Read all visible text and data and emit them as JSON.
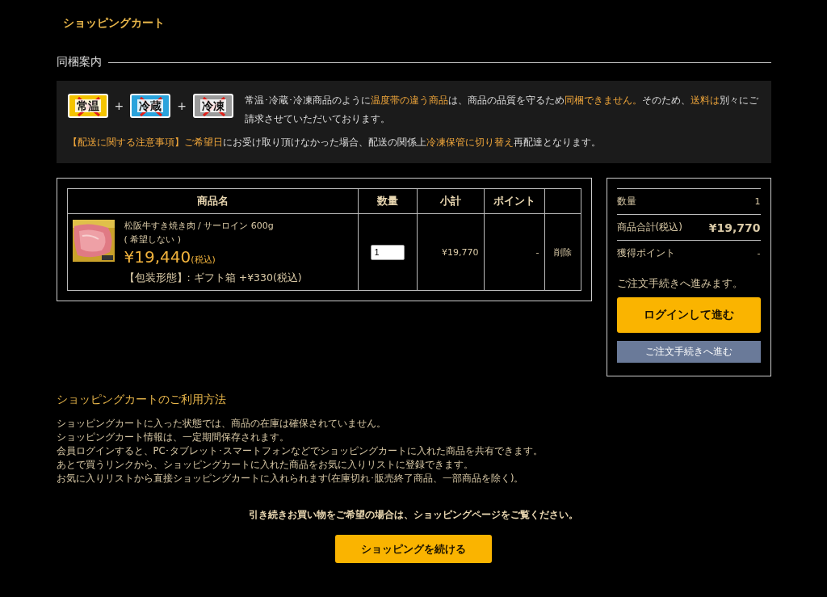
{
  "title": "ショッピングカート",
  "bundle_notice": {
    "heading": "同梱案内",
    "badges": [
      {
        "label": "常温",
        "color": "#f5c400"
      },
      {
        "label": "冷蔵",
        "color": "#2aa3dc"
      },
      {
        "label": "冷凍",
        "color": "#9a9a9a"
      }
    ],
    "separators": [
      "+",
      "+"
    ],
    "message": "常温･冷蔵･冷凍商品のように**温度帯の違う商品**は、商品の品質を守るため**同梱できません。**そのため、**送料は**別々にご請求させていただいております。",
    "caution": "**【配送に関する注意事項】ご希望日**にお受け取り頂けなかった場合、配送の関係上**冷凍保管に切り替え**再配達となります。"
  },
  "cart": {
    "columns": [
      "商品名",
      "数量",
      "小計",
      "ポイント"
    ],
    "item": {
      "name": "松阪牛すき焼き肉 / サーロイン 600g",
      "option": "( 希望しない )",
      "price": "¥19,440",
      "tax_note": "(税込)",
      "wrapping": "【包装形態】: ギフト箱 +¥330(税込)",
      "quantity": "1",
      "subtotal": "¥19,770",
      "points": "-",
      "delete": "削除"
    }
  },
  "summary": {
    "rows": [
      {
        "label": "数量",
        "value": "1",
        "kind": "plain"
      },
      {
        "label": "商品合計(税込)",
        "value": "¥19,770",
        "kind": "total"
      },
      {
        "label": "獲得ポイント",
        "value": "-",
        "kind": "plain"
      }
    ],
    "note": "ご注文手続きへ進みます。",
    "login_button": "ログインして進む",
    "proceed_button": "ご注文手続きへ進む"
  },
  "usage": {
    "heading": "ショッピングカートのご利用方法",
    "lines": [
      "ショッピングカートに入った状態では、商品の在庫は確保されていません。",
      "ショッピングカート情報は、一定期間保存されます。",
      "会員ログインすると、PC･タブレット･スマートフォンなどでショッピングカートに入れた商品を共有できます。",
      "あとで買うリンクから、ショッピングカートに入れた商品をお気に入りリストに登録できます。",
      "お気に入りリストから直接ショッピングカートに入れられます(在庫切れ･販売終了商品、一部商品を除く)。"
    ]
  },
  "continue": {
    "message": "引き続きお買い物をご希望の場合は、ショッピングページをご覧ください。",
    "button": "ショッピングを続ける"
  }
}
